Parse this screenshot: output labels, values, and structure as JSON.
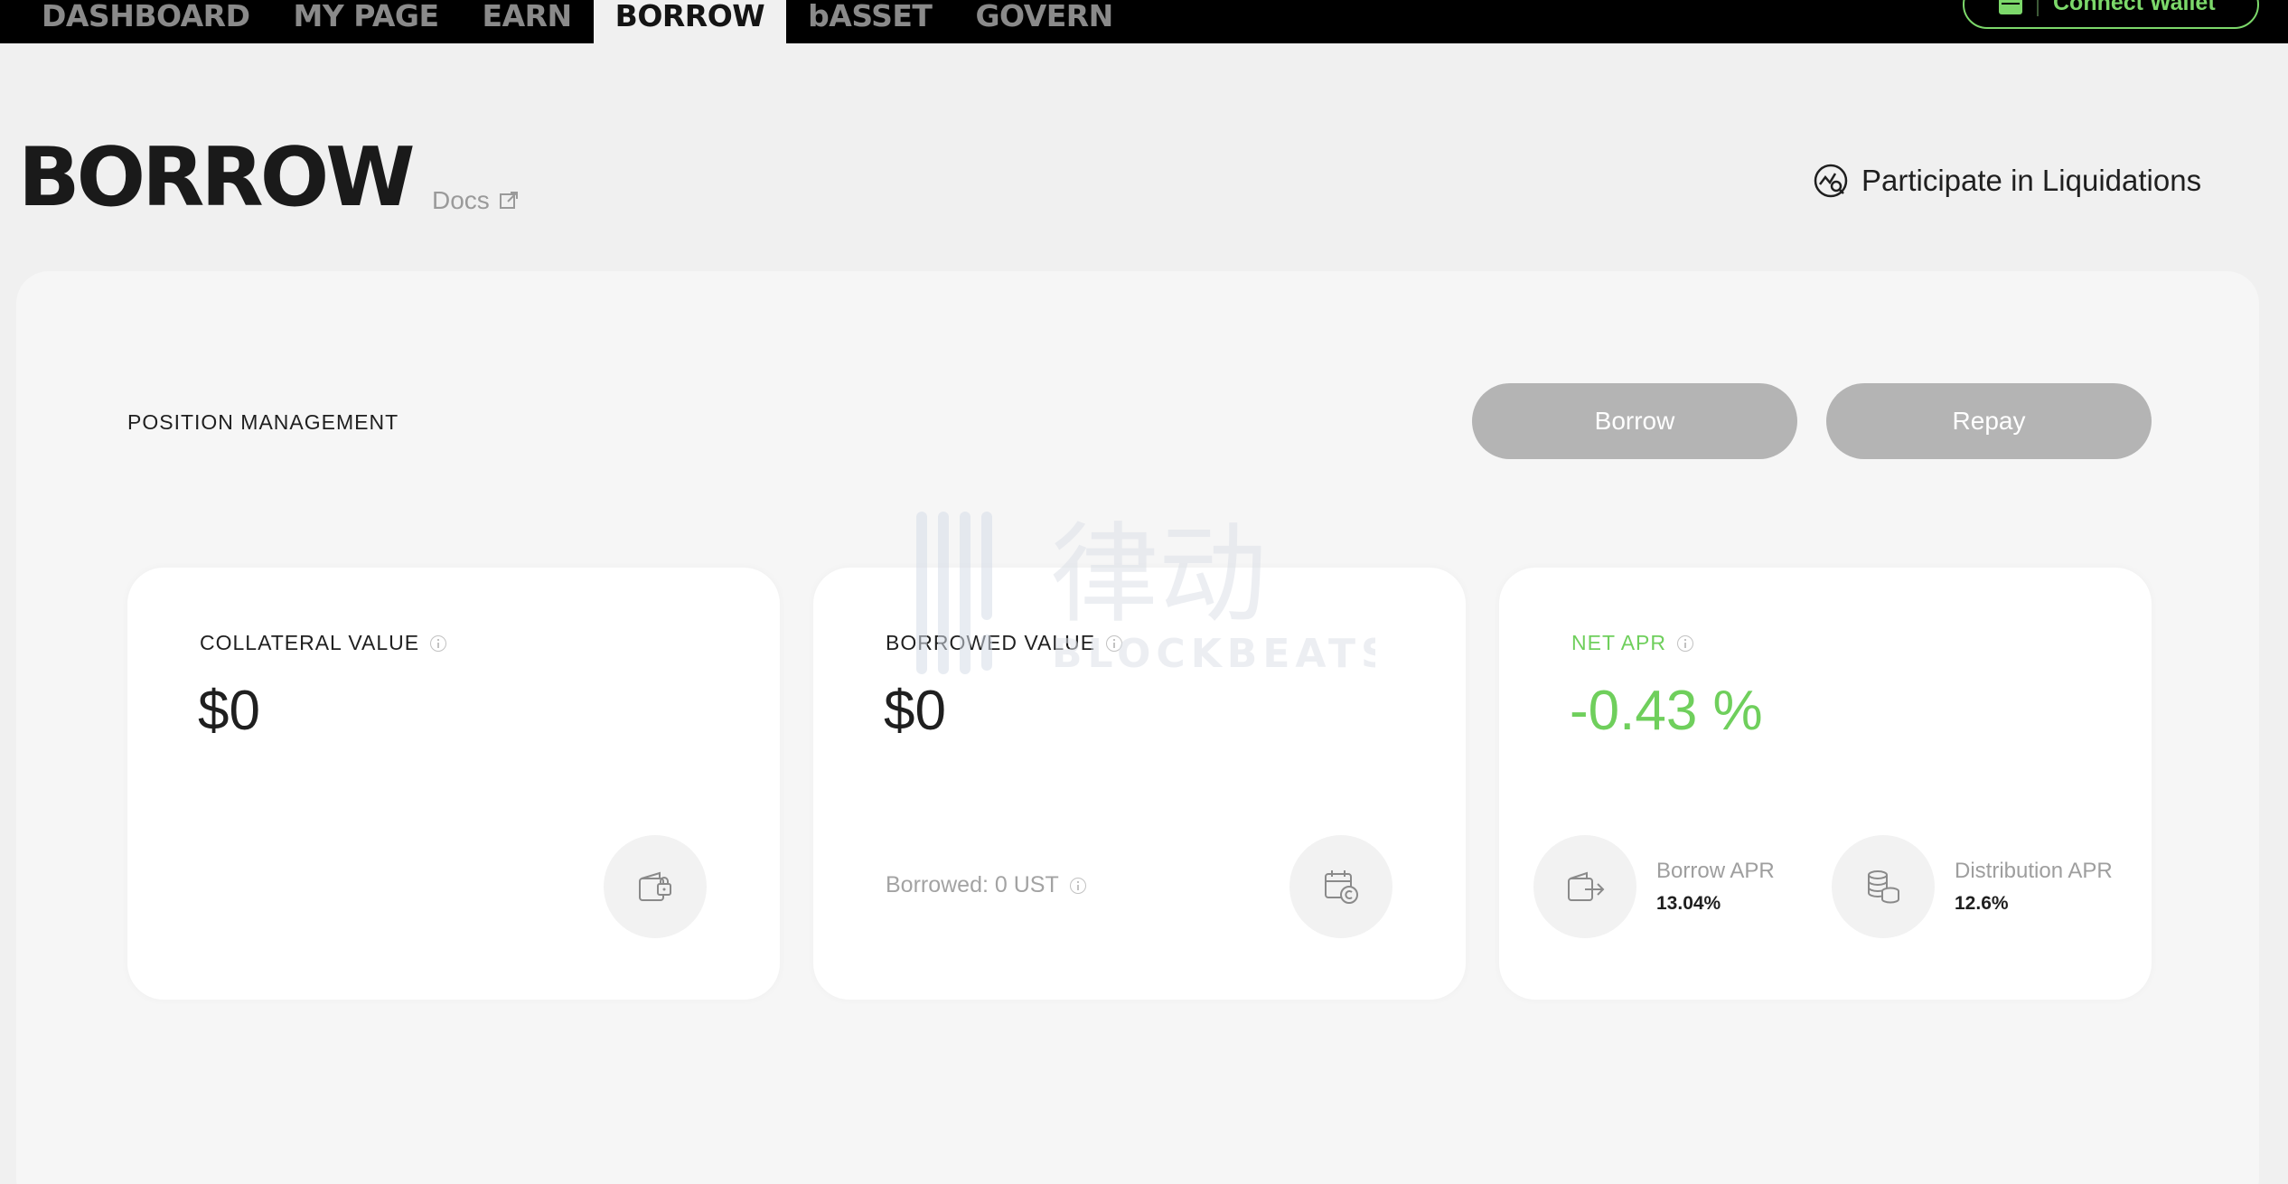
{
  "nav": {
    "items": [
      {
        "label": "DASHBOARD"
      },
      {
        "label": "MY PAGE"
      },
      {
        "label": "EARN"
      },
      {
        "label": "BORROW"
      },
      {
        "label": "bASSET"
      },
      {
        "label": "GOVERN"
      }
    ],
    "active": "BORROW",
    "connect_wallet": "Connect Wallet"
  },
  "header": {
    "title": "BORROW",
    "docs": "Docs",
    "liquidations": "Participate in Liquidations"
  },
  "position": {
    "title": "POSITION MANAGEMENT",
    "borrow_btn": "Borrow",
    "repay_btn": "Repay"
  },
  "collateral": {
    "label": "COLLATERAL VALUE",
    "value": "$0"
  },
  "borrowed": {
    "label": "BORROWED VALUE",
    "value": "$0",
    "sub": "Borrowed: 0 UST"
  },
  "net_apr": {
    "label": "NET APR",
    "value": "-0.43 %",
    "borrow_apr_label": "Borrow APR",
    "borrow_apr_value": "13.04%",
    "distribution_apr_label": "Distribution APR",
    "distribution_apr_value": "12.6%"
  },
  "watermark": {
    "brand_cn": "律动",
    "brand_en": "BLOCKBEATS"
  },
  "colors": {
    "accent_green": "#6fcf5c",
    "button_gray": "#b4b4b4",
    "nav_bg": "#000000"
  }
}
